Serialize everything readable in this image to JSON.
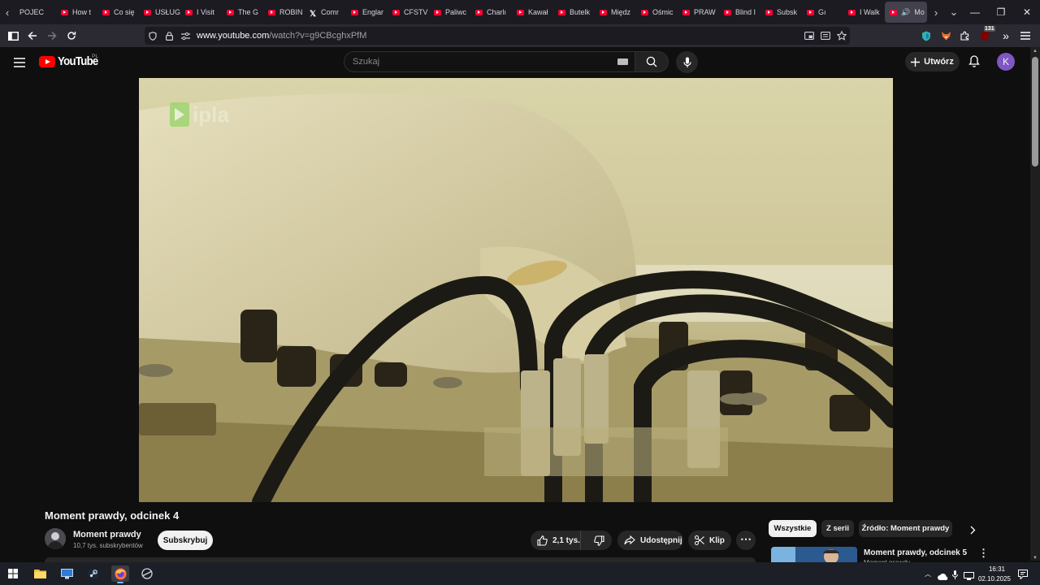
{
  "browser": {
    "tabs": [
      {
        "label": "POJEC",
        "icon": "none"
      },
      {
        "label": "How t",
        "icon": "youtube"
      },
      {
        "label": "Co się",
        "icon": "youtube"
      },
      {
        "label": "USŁUG",
        "icon": "youtube"
      },
      {
        "label": "I Visit",
        "icon": "youtube"
      },
      {
        "label": "The G",
        "icon": "youtube"
      },
      {
        "label": "ROBIN",
        "icon": "youtube"
      },
      {
        "label": "Comr",
        "icon": "x"
      },
      {
        "label": "Englar",
        "icon": "youtube"
      },
      {
        "label": "CFSTV",
        "icon": "youtube"
      },
      {
        "label": "Paliwc",
        "icon": "youtube"
      },
      {
        "label": "Charlı",
        "icon": "youtube"
      },
      {
        "label": "Kawał",
        "icon": "youtube"
      },
      {
        "label": "Butelk",
        "icon": "youtube"
      },
      {
        "label": "Międz",
        "icon": "youtube"
      },
      {
        "label": "Ośmic",
        "icon": "youtube"
      },
      {
        "label": "PRAW",
        "icon": "youtube"
      },
      {
        "label": "Blind I",
        "icon": "youtube"
      },
      {
        "label": "Subsk",
        "icon": "youtube"
      },
      {
        "label": "Gı",
        "icon": "youtube"
      },
      {
        "label": "I Walk",
        "icon": "youtube"
      },
      {
        "label": "Mo",
        "icon": "youtube",
        "active": true
      }
    ],
    "url_domain": "www.youtube.com",
    "url_path": "/watch?v=g9CBcghxPfM",
    "extension_badge": "131"
  },
  "youtube": {
    "logo_text": "YouTube",
    "region": "PL",
    "search_placeholder": "Szukaj",
    "create_label": "Utwórz",
    "avatar_letter": "K",
    "video_watermark": "ipla",
    "video_title": "Moment prawdy, odcinek 4",
    "channel_name": "Moment prawdy",
    "channel_subs": "10,7 tys. subskrybentów",
    "subscribe_label": "Subskrybuj",
    "like_count": "2,1 tys.",
    "share_label": "Udostępnij",
    "clip_label": "Klip",
    "chips": [
      "Wszystkie",
      "Z serii",
      "Źródło: Moment prawdy"
    ],
    "up_next_title": "Moment prawdy, odcinek 5",
    "up_next_channel": "Moment prawdy"
  },
  "taskbar": {
    "time": "16:31",
    "date": "02.10.2025"
  },
  "colors": {
    "youtube_red": "#ff0000",
    "avatar_purple": "#7e57c2",
    "page_bg": "#0f0f0f"
  }
}
